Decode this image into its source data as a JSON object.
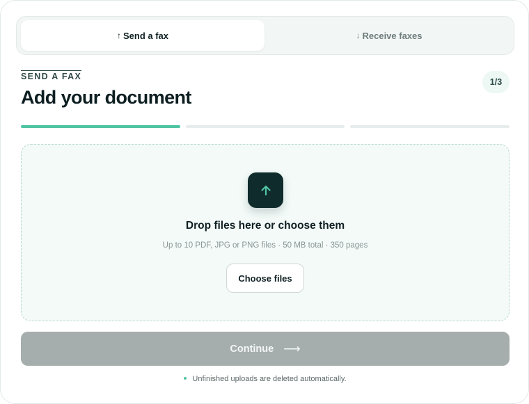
{
  "tabs": {
    "send": {
      "arrow": "↑",
      "label": "Send a fax"
    },
    "receive": {
      "arrow": "↓",
      "label": "Receive faxes"
    }
  },
  "header": {
    "eyebrow": "SEND A FAX",
    "title": "Add your document",
    "step_badge": "1/3"
  },
  "progress": {
    "current_step": 1,
    "total_steps": 3
  },
  "dropzone": {
    "icon": "arrow-up-icon",
    "title": "Drop files here or choose them",
    "hint": "Up to 10 PDF, JPG or PNG files · 50 MB total · 350 pages",
    "choose_label": "Choose files"
  },
  "footer": {
    "continue_label": "Continue",
    "continue_arrow": "⟶",
    "note": "Unfinished uploads are deleted automatically."
  },
  "colors": {
    "accent": "#4fc4a3",
    "dark": "#0f2b2c",
    "disabled_button": "#a5adad",
    "dropzone_bg": "#f3faf8"
  }
}
